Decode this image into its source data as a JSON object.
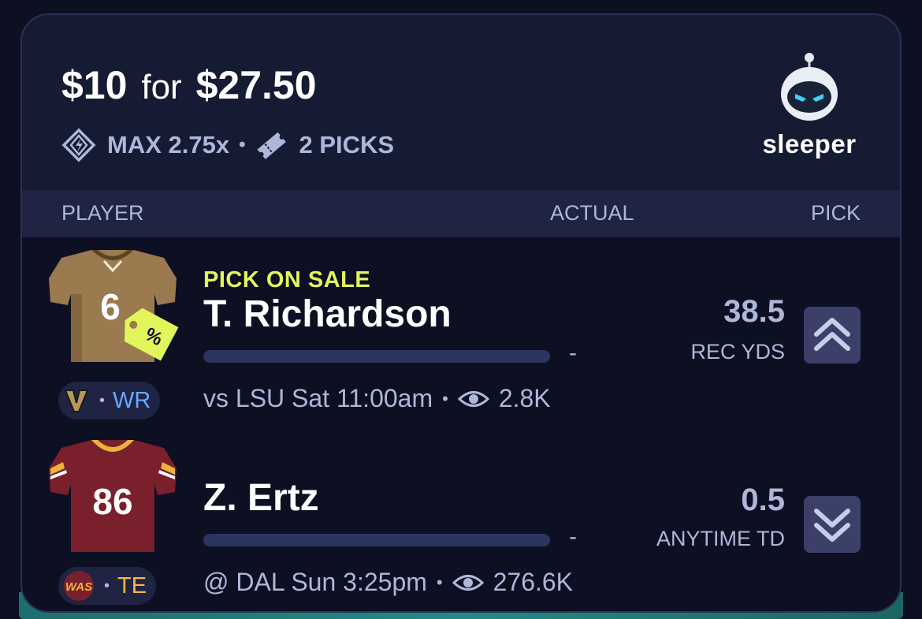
{
  "header": {
    "stake": "$10",
    "for_word": "for",
    "payout": "$27.50",
    "max_multiplier": "MAX 2.75x",
    "separator": "•",
    "picks_count": "2 PICKS",
    "brand": "sleeper"
  },
  "columns": {
    "player": "PLAYER",
    "actual": "ACTUAL",
    "pick": "PICK"
  },
  "picks": [
    {
      "promo": "PICK ON SALE",
      "name": "T. Richardson",
      "jersey_number": "6",
      "team_abbr": "V",
      "position": "WR",
      "actual": "-",
      "matchup": "vs LSU Sat 11:00am",
      "views": "2.8K",
      "line": "38.5",
      "stat": "REC YDS",
      "direction": "higher",
      "jersey_color": "#9a7a4e",
      "icon": "chevron-double-up-icon"
    },
    {
      "promo": "",
      "name": "Z. Ertz",
      "jersey_number": "86",
      "team_abbr": "WAS",
      "position": "TE",
      "actual": "-",
      "matchup": "@ DAL Sun 3:25pm",
      "views": "276.6K",
      "line": "0.5",
      "stat": "ANYTIME TD",
      "direction": "lower",
      "jersey_color": "#7a1f2c",
      "icon": "chevron-double-down-icon"
    }
  ],
  "colors": {
    "background": "#0c1022",
    "card": "#161b34",
    "sale": "#e2f55a",
    "wr_position": "#6aa8ff",
    "te_position": "#ffb347",
    "muted_text": "#aeb7d8"
  }
}
